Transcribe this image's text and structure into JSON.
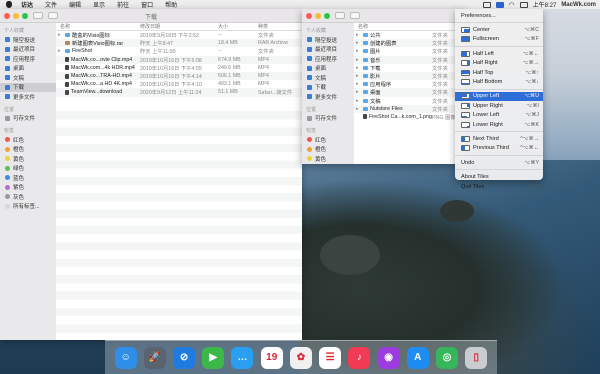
{
  "menubar": {
    "items": [
      "访达",
      "文件",
      "编辑",
      "显示",
      "前往",
      "窗口",
      "帮助"
    ],
    "time": "上午8:27",
    "brand": "MacWk.com"
  },
  "finder1": {
    "title": "下载",
    "sidebar": {
      "favorites_header": "个人收藏",
      "favorites": [
        "隔空投送",
        "最近项目",
        "应用程序",
        "桌面",
        "文稿",
        "下载",
        "更多文件"
      ],
      "devices_header": "位置",
      "devices": [
        "可存文件"
      ],
      "tags_header": "标签",
      "tags": [
        {
          "label": "红色",
          "color": "#f0564a"
        },
        {
          "label": "橙色",
          "color": "#f5a030"
        },
        {
          "label": "黄色",
          "color": "#f3d13a"
        },
        {
          "label": "绿色",
          "color": "#5ac155"
        },
        {
          "label": "蓝色",
          "color": "#3a8bef"
        },
        {
          "label": "紫色",
          "color": "#b46bd6"
        },
        {
          "label": "灰色",
          "color": "#9a9a9a"
        },
        {
          "label": "所有标签...",
          "color": "#d8d8d8"
        }
      ]
    },
    "columns": [
      "名称",
      "修改日期",
      "大小",
      "种类"
    ],
    "rows": [
      {
        "name": "酷盒的Visio图标",
        "date": "2019年9月18日 下午2:52",
        "size": "--",
        "kind": "文件夹",
        "type": "folder",
        "disc": "▸"
      },
      {
        "name": "新建图表Visio图标.rar",
        "date": "昨天 上午8:47",
        "size": "18.4 MB",
        "kind": "RAR Archive",
        "type": "arch",
        "disc": ""
      },
      {
        "name": "FireShot",
        "date": "昨天 上午11:00",
        "size": "--",
        "kind": "文件夹",
        "type": "folder",
        "disc": "▸"
      },
      {
        "name": "MacWk.co...ovie Clip.mp4",
        "date": "2019年10月16日 下午5:08",
        "size": "674.9 MB",
        "kind": "MP4",
        "type": "file",
        "disc": ""
      },
      {
        "name": "MacWk.com...4k HDR.mp4",
        "date": "2019年10月16日 下午4:55",
        "size": "249.6 MB",
        "kind": "MP4",
        "type": "file",
        "disc": ""
      },
      {
        "name": "MacWk.co...TRA-HD.mp4",
        "date": "2019年10月16日 下午4:14",
        "size": "506.1 MB",
        "kind": "MP4",
        "type": "file",
        "disc": ""
      },
      {
        "name": "MacWk.co...a HD 4K.mp4",
        "date": "2019年10月16日 下午4:10",
        "size": "483.1 MB",
        "kind": "MP4",
        "type": "file",
        "disc": ""
      },
      {
        "name": "TeamView...download",
        "date": "2020年9月12日 上午11:24",
        "size": "51.1 MB",
        "kind": "Safari...接文件",
        "type": "file",
        "disc": ""
      }
    ]
  },
  "finder2": {
    "sidebar": {
      "favorites_header": "个人收藏",
      "favorites": [
        "隔空投送",
        "最近项目",
        "应用程序",
        "桌面",
        "文稿",
        "下载",
        "更多文件"
      ],
      "devices_header": "位置",
      "devices": [
        "可存文件"
      ],
      "tags_header": "标签",
      "tags": [
        {
          "label": "红色",
          "color": "#f0564a"
        },
        {
          "label": "橙色",
          "color": "#f5a030"
        },
        {
          "label": "黄色",
          "color": "#f3d13a"
        }
      ]
    },
    "column_name": "名称",
    "rows": [
      "公共",
      "创建的图表",
      "图片",
      "音乐",
      "下载",
      "影片",
      "应用程序",
      "桌面",
      "文稿",
      "Nutstore Files",
      "FireShot Ca...k.com_1.png"
    ],
    "kinds": [
      "文件夹",
      "文件夹",
      "文件夹",
      "文件夹",
      "文件夹",
      "文件夹",
      "文件夹",
      "文件夹",
      "文件夹",
      "文件夹",
      "PNG 图像"
    ]
  },
  "tiles_menu": {
    "items": [
      {
        "label": "Preferences...",
        "shortcut": "",
        "icon": "none",
        "highlight": false
      },
      {
        "sep": true
      },
      {
        "label": "Center",
        "shortcut": "⌥⌘C",
        "icon": "center",
        "highlight": false
      },
      {
        "label": "Fullscreen",
        "shortcut": "⌥⌘F",
        "icon": "full",
        "highlight": false
      },
      {
        "sep": true
      },
      {
        "label": "Half Left",
        "shortcut": "⌥⌘←",
        "icon": "hleft",
        "highlight": false
      },
      {
        "label": "Half Right",
        "shortcut": "⌥⌘→",
        "icon": "hright",
        "highlight": false
      },
      {
        "label": "Half Top",
        "shortcut": "⌥⌘↑",
        "icon": "htop",
        "highlight": false
      },
      {
        "label": "Half Bottom",
        "shortcut": "⌥⌘↓",
        "icon": "hbottom",
        "highlight": false
      },
      {
        "sep": true
      },
      {
        "label": "Upper Left",
        "shortcut": "⌥⌘U",
        "icon": "ul",
        "highlight": true
      },
      {
        "label": "Upper Right",
        "shortcut": "⌥⌘I",
        "icon": "ur",
        "highlight": false
      },
      {
        "label": "Lower Left",
        "shortcut": "⌥⌘J",
        "icon": "ll",
        "highlight": false
      },
      {
        "label": "Lower Right",
        "shortcut": "⌥⌘K",
        "icon": "lr",
        "highlight": false
      },
      {
        "sep": true
      },
      {
        "label": "Next Third",
        "shortcut": "^⌥⌘→",
        "icon": "third",
        "highlight": false
      },
      {
        "label": "Previous Third",
        "shortcut": "^⌥⌘←",
        "icon": "third",
        "highlight": false
      },
      {
        "sep": true
      },
      {
        "label": "Undo",
        "shortcut": "⌥⌘Y",
        "icon": "none",
        "highlight": false
      },
      {
        "sep": true
      },
      {
        "label": "About Tiles",
        "shortcut": "",
        "icon": "none",
        "highlight": false
      },
      {
        "label": "Quit Tiles",
        "shortcut": "⌘Q",
        "icon": "none",
        "highlight": false
      }
    ]
  },
  "dock": {
    "apps": [
      {
        "name": "finder-icon",
        "color": "#2f8fe8",
        "glyph": "☺"
      },
      {
        "name": "launchpad-icon",
        "color": "#5a6470",
        "glyph": "🚀"
      },
      {
        "name": "safari-icon",
        "color": "#1f7be0",
        "glyph": "⊘"
      },
      {
        "name": "facetime-icon",
        "color": "#3cb84a",
        "glyph": "▶"
      },
      {
        "name": "messages-icon",
        "color": "#2a9ff0",
        "glyph": "…"
      },
      {
        "name": "calendar-icon",
        "color": "#ffffff",
        "glyph": "19"
      },
      {
        "name": "photos-icon",
        "color": "#f0f0f0",
        "glyph": "✿"
      },
      {
        "name": "reminders-icon",
        "color": "#ffffff",
        "glyph": "☰"
      },
      {
        "name": "music-icon",
        "color": "#f23a54",
        "glyph": "♪"
      },
      {
        "name": "podcasts-icon",
        "color": "#9b3be0",
        "glyph": "◉"
      },
      {
        "name": "appstore-icon",
        "color": "#1e8cf0",
        "glyph": "A"
      },
      {
        "name": "findmy-icon",
        "color": "#36b65a",
        "glyph": "◎"
      },
      {
        "name": "trash-icon",
        "color": "#c9cdd2",
        "glyph": "▯"
      }
    ]
  },
  "colors": {
    "accent": "#2f6ed8",
    "selection": "#d7d7da"
  }
}
